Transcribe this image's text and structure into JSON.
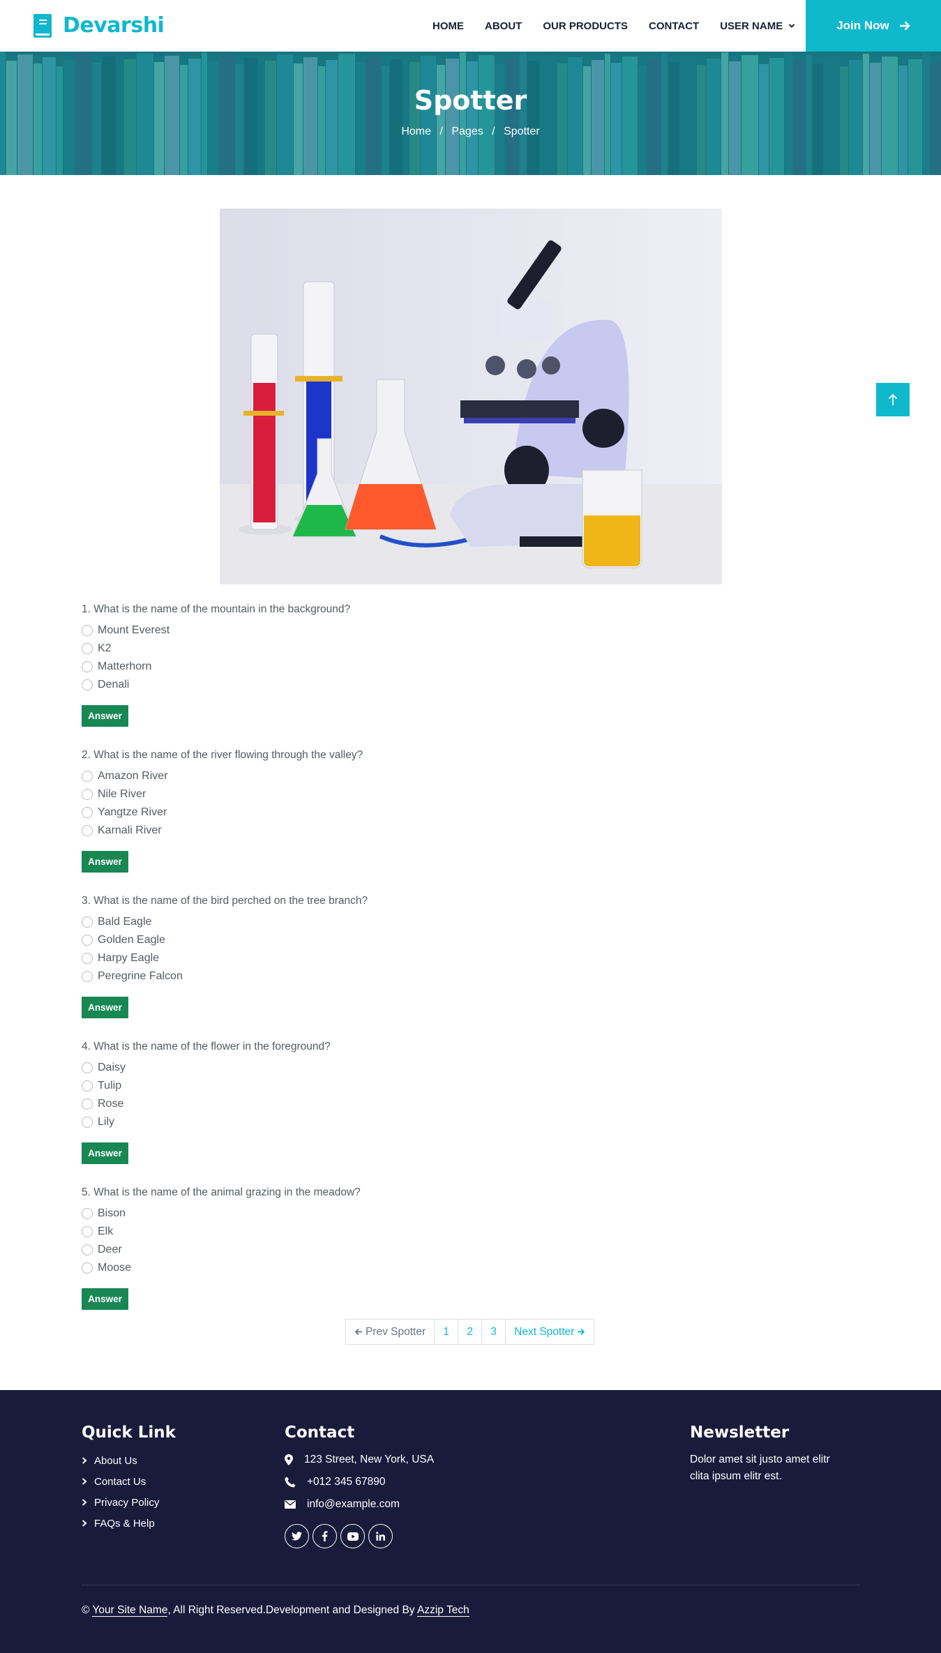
{
  "brand": {
    "name": "Devarshi",
    "color": "#0fb8cc"
  },
  "nav": {
    "items": [
      "HOME",
      "ABOUT",
      "OUR PRODUCTS",
      "CONTACT",
      "USER NAME"
    ],
    "join_label": "Join Now"
  },
  "hero": {
    "title": "Spotter",
    "breadcrumb": [
      "Home",
      "Pages",
      "Spotter"
    ],
    "separator": "/"
  },
  "questions": [
    {
      "text": "1. What is the name of the mountain in the background?",
      "options": [
        "Mount Everest",
        "K2",
        "Matterhorn",
        "Denali"
      ],
      "button": "Answer"
    },
    {
      "text": "2. What is the name of the river flowing through the valley?",
      "options": [
        "Amazon River",
        "Nile River",
        "Yangtze River",
        "Karnali River"
      ],
      "button": "Answer"
    },
    {
      "text": "3. What is the name of the bird perched on the tree branch?",
      "options": [
        "Bald Eagle",
        "Golden Eagle",
        "Harpy Eagle",
        "Peregrine Falcon"
      ],
      "button": "Answer"
    },
    {
      "text": "4. What is the name of the flower in the foreground?",
      "options": [
        "Daisy",
        "Tulip",
        "Rose",
        "Lily"
      ],
      "button": "Answer"
    },
    {
      "text": "5. What is the name of the animal grazing in the meadow?",
      "options": [
        "Bison",
        "Elk",
        "Deer",
        "Moose"
      ],
      "button": "Answer"
    }
  ],
  "pagination": {
    "prev": "Prev Spotter",
    "pages": [
      "1",
      "2",
      "3"
    ],
    "next": "Next Spotter"
  },
  "footer": {
    "quick_link_title": "Quick Link",
    "quick_links": [
      "About Us",
      "Contact Us",
      "Privacy Policy",
      "FAQs & Help"
    ],
    "contact_title": "Contact",
    "address": "123 Street, New York, USA",
    "phone": "+012 345 67890",
    "email": "info@example.com",
    "socials": [
      "twitter-icon",
      "facebook-icon",
      "youtube-icon",
      "linkedin-icon"
    ],
    "newsletter_title": "Newsletter",
    "newsletter_text": "Dolor amet sit justo amet elitr clita ipsum elitr est.",
    "copyright_prefix": "©",
    "site_name": "Your Site Name",
    "copyright_middle": ", All Right Reserved.Development and Designed By",
    "designer": "Azzip Tech"
  },
  "colors": {
    "accent": "#10b8cc",
    "answer": "#198754",
    "footer_bg": "#181b3a"
  }
}
